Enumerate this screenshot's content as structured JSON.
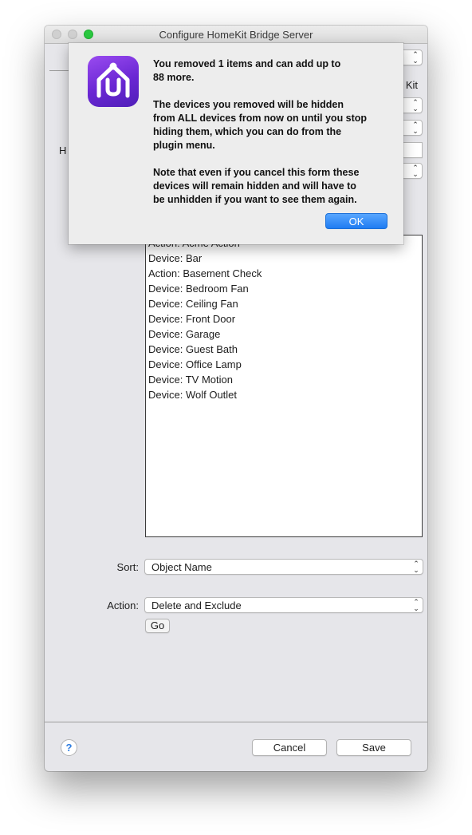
{
  "window": {
    "title": "Configure HomeKit Bridge Server"
  },
  "background_fragments": {
    "kit_text": "Kit",
    "h_text": "H"
  },
  "alert": {
    "line1a": "You removed 1 items and can add up to",
    "line1b": "88 more.",
    "line2a": "The devices you removed will be hidden",
    "line2b": "from ALL devices from now on until you stop",
    "line2c": "hiding them, which you can do from the",
    "line2d": "plugin menu.",
    "line3a": "Note that even if you cancel this form these",
    "line3b": "devices will remain hidden and will have to",
    "line3c": "be unhidden if you want to see them again.",
    "ok_label": "OK",
    "icon": "homekit-house-icon",
    "icon_color": "#7a34e0"
  },
  "list": {
    "items": [
      "Action: Acme Action",
      "Device: Bar",
      "Action: Basement Check",
      "Device: Bedroom Fan",
      "Device: Ceiling Fan",
      "Device: Front Door",
      "Device: Garage",
      "Device: Guest Bath",
      "Device: Office Lamp",
      "Device: TV Motion",
      "Device: Wolf Outlet"
    ]
  },
  "sort": {
    "label": "Sort:",
    "value": "Object Name"
  },
  "action": {
    "label": "Action:",
    "value": "Delete and Exclude",
    "go_label": "Go"
  },
  "footer": {
    "help_label": "?",
    "cancel_label": "Cancel",
    "save_label": "Save"
  },
  "colors": {
    "ok_button": "#2a84f5",
    "window_bg": "#e6e6ea"
  }
}
